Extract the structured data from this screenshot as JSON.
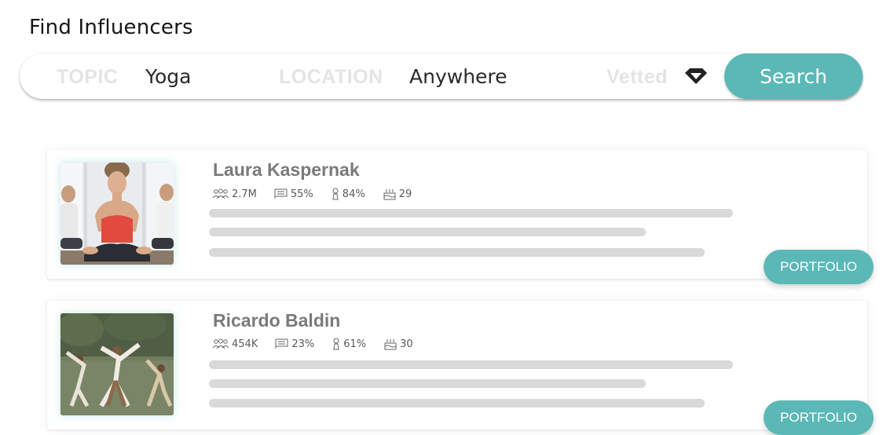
{
  "page_title": "Find Influencers",
  "search": {
    "topic_label": "TOPIC",
    "topic_value": "Yoga",
    "location_label": "LOCATION",
    "location_value": "Anywhere",
    "vetted_label": "Vetted",
    "search_button": "Search"
  },
  "influencers": [
    {
      "name": "Laura Kaspernak",
      "followers": "2.7M",
      "engagement": "55%",
      "female": "84%",
      "age": "29",
      "portfolio_label": "PORTFOLIO"
    },
    {
      "name": "Ricardo Baldin",
      "followers": "454K",
      "engagement": "23%",
      "female": "61%",
      "age": "30",
      "portfolio_label": "PORTFOLIO"
    }
  ],
  "colors": {
    "accent": "#5ab8b7",
    "placeholder_bar": "#d9d9d9",
    "muted_label": "#e4e4e4"
  }
}
